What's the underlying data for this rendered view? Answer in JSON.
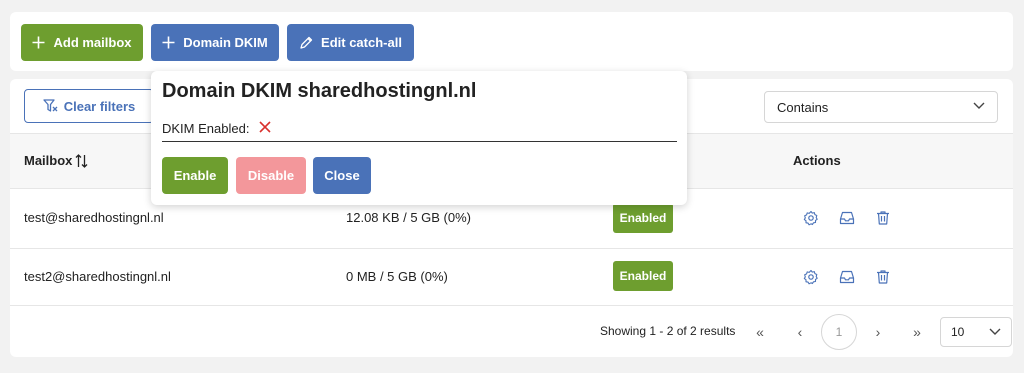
{
  "toolbar": {
    "add_mailbox_label": "Add mailbox",
    "domain_dkim_label": "Domain DKIM",
    "edit_catchall_label": "Edit catch-all"
  },
  "filters": {
    "clear_filters_label": "Clear filters",
    "match_mode": "Contains"
  },
  "table": {
    "headers": {
      "mailbox": "Mailbox",
      "actions": "Actions"
    },
    "rows": [
      {
        "mailbox": "test@sharedhostingnl.nl",
        "usage": "12.08 KB / 5 GB (0%)",
        "status": "Enabled"
      },
      {
        "mailbox": "test2@sharedhostingnl.nl",
        "usage": "0 MB / 5 GB (0%)",
        "status": "Enabled"
      }
    ]
  },
  "pagination": {
    "summary": "Showing 1 - 2 of 2 results",
    "first_label": "«",
    "prev_label": "‹",
    "next_label": "›",
    "last_label": "»",
    "current_page": "1",
    "page_size": "10"
  },
  "popover": {
    "title": "Domain DKIM sharedhostingnl.nl",
    "dkim_enabled_label": "DKIM Enabled:",
    "enable_label": "Enable",
    "disable_label": "Disable",
    "close_label": "Close"
  },
  "colors": {
    "green": "#6e9e2f",
    "blue": "#4a72b8",
    "pink": "#f3979b",
    "error_red": "#d9302c"
  },
  "icons": [
    "plus-icon",
    "pencil-icon",
    "filter-clear-icon",
    "sort-icon",
    "chevron-down-icon",
    "gear-icon",
    "inbox-icon",
    "trash-icon",
    "x-icon"
  ]
}
